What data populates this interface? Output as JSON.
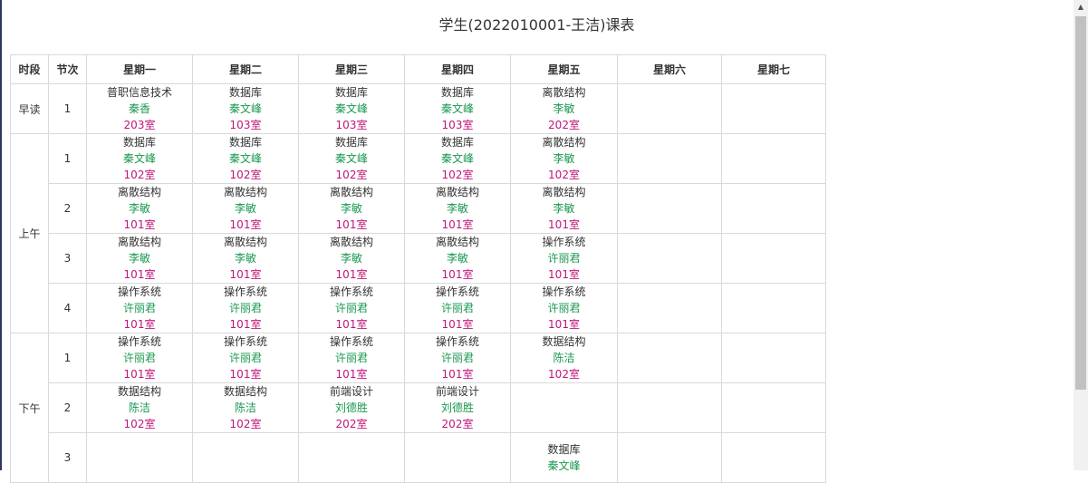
{
  "title": "学生(2022010001-王洁)课表",
  "header": [
    "时段",
    "节次",
    "星期一",
    "星期二",
    "星期三",
    "星期四",
    "星期五",
    "星期六",
    "星期七"
  ],
  "periods": [
    {
      "label": "早读",
      "rows": [
        {
          "num": "1",
          "cells": [
            {
              "course": "普职信息技术",
              "teacher": "秦香",
              "room": "203室"
            },
            {
              "course": "数据库",
              "teacher": "秦文峰",
              "room": "103室"
            },
            {
              "course": "数据库",
              "teacher": "秦文峰",
              "room": "103室"
            },
            {
              "course": "数据库",
              "teacher": "秦文峰",
              "room": "103室"
            },
            {
              "course": "离散结构",
              "teacher": "李敏",
              "room": "202室"
            },
            null,
            null
          ]
        }
      ]
    },
    {
      "label": "上午",
      "rows": [
        {
          "num": "1",
          "cells": [
            {
              "course": "数据库",
              "teacher": "秦文峰",
              "room": "102室"
            },
            {
              "course": "数据库",
              "teacher": "秦文峰",
              "room": "102室"
            },
            {
              "course": "数据库",
              "teacher": "秦文峰",
              "room": "102室"
            },
            {
              "course": "数据库",
              "teacher": "秦文峰",
              "room": "102室"
            },
            {
              "course": "离散结构",
              "teacher": "李敏",
              "room": "102室"
            },
            null,
            null
          ]
        },
        {
          "num": "2",
          "cells": [
            {
              "course": "离散结构",
              "teacher": "李敏",
              "room": "101室"
            },
            {
              "course": "离散结构",
              "teacher": "李敏",
              "room": "101室"
            },
            {
              "course": "离散结构",
              "teacher": "李敏",
              "room": "101室"
            },
            {
              "course": "离散结构",
              "teacher": "李敏",
              "room": "101室"
            },
            {
              "course": "离散结构",
              "teacher": "李敏",
              "room": "101室"
            },
            null,
            null
          ]
        },
        {
          "num": "3",
          "cells": [
            {
              "course": "离散结构",
              "teacher": "李敏",
              "room": "101室"
            },
            {
              "course": "离散结构",
              "teacher": "李敏",
              "room": "101室"
            },
            {
              "course": "离散结构",
              "teacher": "李敏",
              "room": "101室"
            },
            {
              "course": "离散结构",
              "teacher": "李敏",
              "room": "101室"
            },
            {
              "course": "操作系统",
              "teacher": "许丽君",
              "room": "101室"
            },
            null,
            null
          ]
        },
        {
          "num": "4",
          "cells": [
            {
              "course": "操作系统",
              "teacher": "许丽君",
              "room": "101室"
            },
            {
              "course": "操作系统",
              "teacher": "许丽君",
              "room": "101室"
            },
            {
              "course": "操作系统",
              "teacher": "许丽君",
              "room": "101室"
            },
            {
              "course": "操作系统",
              "teacher": "许丽君",
              "room": "101室"
            },
            {
              "course": "操作系统",
              "teacher": "许丽君",
              "room": "101室"
            },
            null,
            null
          ]
        }
      ]
    },
    {
      "label": "下午",
      "rows": [
        {
          "num": "1",
          "cells": [
            {
              "course": "操作系统",
              "teacher": "许丽君",
              "room": "101室"
            },
            {
              "course": "操作系统",
              "teacher": "许丽君",
              "room": "101室"
            },
            {
              "course": "操作系统",
              "teacher": "许丽君",
              "room": "101室"
            },
            {
              "course": "操作系统",
              "teacher": "许丽君",
              "room": "101室"
            },
            {
              "course": "数据结构",
              "teacher": "陈洁",
              "room": "102室"
            },
            null,
            null
          ]
        },
        {
          "num": "2",
          "cells": [
            {
              "course": "数据结构",
              "teacher": "陈洁",
              "room": "102室"
            },
            {
              "course": "数据结构",
              "teacher": "陈洁",
              "room": "102室"
            },
            {
              "course": "前端设计",
              "teacher": "刘德胜",
              "room": "202室"
            },
            {
              "course": "前端设计",
              "teacher": "刘德胜",
              "room": "202室"
            },
            null,
            null,
            null
          ]
        },
        {
          "num": "3",
          "cells": [
            null,
            null,
            null,
            null,
            {
              "course": "数据库",
              "teacher": "秦文峰",
              "room": ""
            },
            null,
            null
          ]
        }
      ]
    }
  ],
  "colors": {
    "teacher": "#1a9850",
    "room": "#c0157a"
  }
}
